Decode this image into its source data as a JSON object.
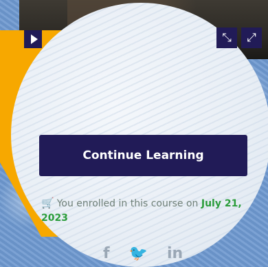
{
  "video_controls": {
    "play_icon": "play-icon",
    "collapse_icon": "collapse-icon",
    "expand_icon": "expand-icon"
  },
  "course": {
    "continue_label": "Continue Learning",
    "enrolled_text": "You enrolled in this course on",
    "enrolled_date": "July 21, 2023",
    "enrolled_icon": "cart-icon"
  },
  "social": {
    "facebook": "f",
    "twitter": "🐦",
    "linkedin": "in"
  },
  "colors": {
    "button": "#211b57",
    "accent_green": "#2a9c3a",
    "highlight_yellow": "#f7a800"
  }
}
